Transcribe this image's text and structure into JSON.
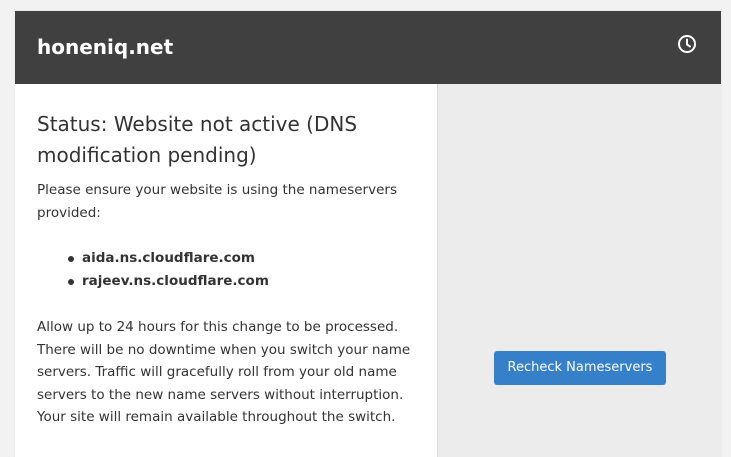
{
  "header": {
    "domain": "honeniq.net",
    "history_icon": "clock-icon"
  },
  "status": {
    "title": "Status: Website not active (DNS modification pending)",
    "intro": "Please ensure your website is using the nameservers provided:",
    "nameservers": [
      "aida.ns.cloudflare.com",
      "rajeev.ns.cloudflare.com"
    ],
    "note": "Allow up to 24 hours for this change to be processed. There will be no downtime when you switch your name servers. Traffic will gracefully roll from your old name servers to the new name servers without interruption. Your site will remain available throughout the switch."
  },
  "actions": {
    "recheck_label": "Recheck Nameservers"
  },
  "colors": {
    "header_bg": "#404040",
    "button_bg": "#3580c8",
    "right_pane_bg": "#ececec"
  }
}
